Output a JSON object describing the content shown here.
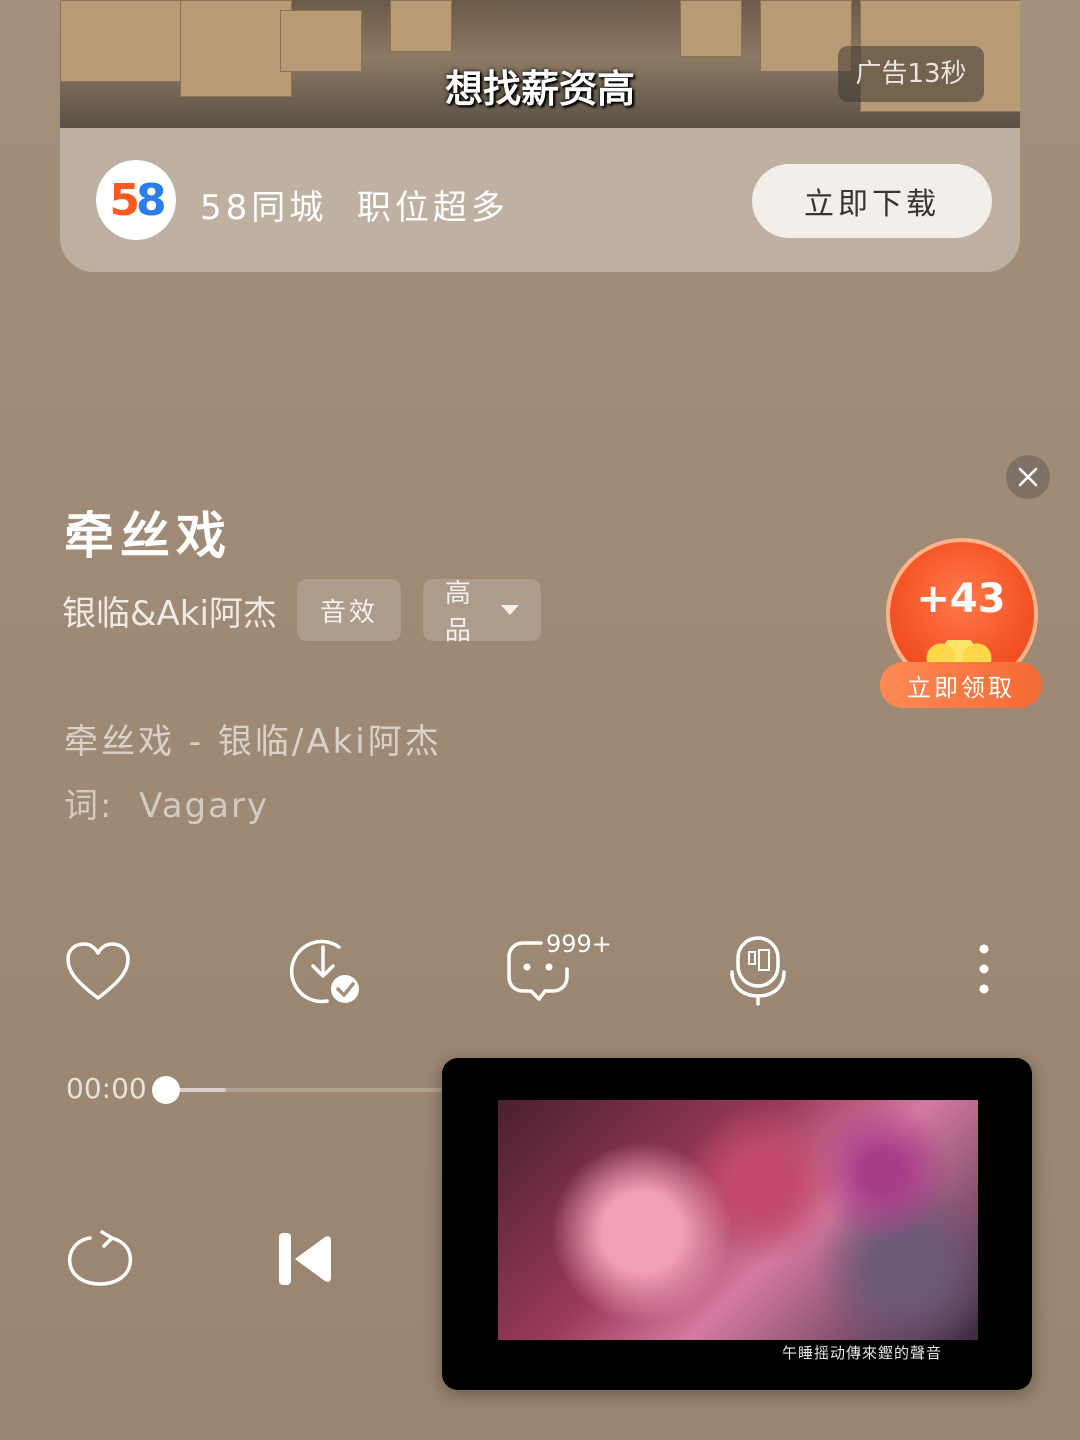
{
  "ad": {
    "caption": "想找薪资高",
    "timer": "广告13秒",
    "brand_text": "58同城  职位超多",
    "download_label": "立即下载",
    "logo_digits": [
      "5",
      "8"
    ]
  },
  "song": {
    "title": "牵丝戏",
    "artist": "银临&Aki阿杰",
    "tag_effects": "音效",
    "tag_quality": "高品"
  },
  "reward": {
    "value": "+43",
    "claim_label": "立即领取"
  },
  "lyrics": {
    "line1": "牵丝戏 - 银临/Aki阿杰",
    "line2": "词:  Vagary"
  },
  "actions": {
    "comment_count": "999+",
    "icons": [
      "heart-icon",
      "download-icon",
      "comment-icon",
      "sing-mic-icon",
      "more-icon"
    ]
  },
  "player": {
    "current_time": "00:00",
    "progress": 0,
    "icons": [
      "repeat-icon",
      "previous-icon"
    ]
  },
  "pip_video": {
    "subtitle": "午睡摇动傳來鏗的聲音"
  },
  "colors": {
    "background": "#a4907b",
    "accent_orange": "#f45224",
    "gold": "#ffd84a"
  }
}
